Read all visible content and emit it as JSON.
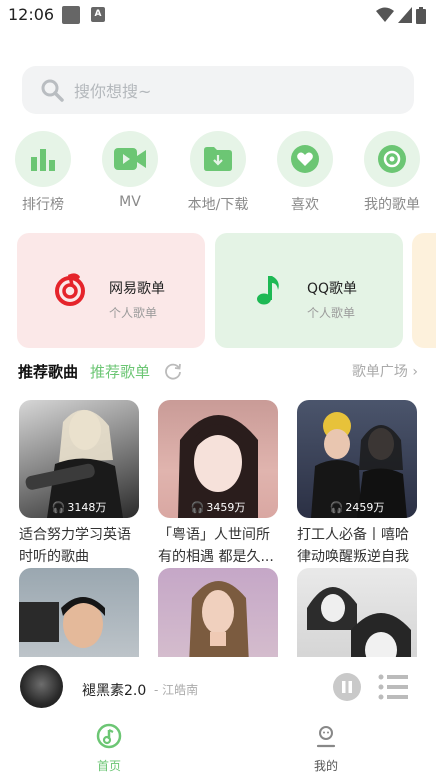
{
  "status": {
    "time": "12:06",
    "notif_letter": "A"
  },
  "search": {
    "placeholder": "搜你想搜~"
  },
  "quick": [
    {
      "label": "排行榜",
      "icon": "bar-chart-icon"
    },
    {
      "label": "MV",
      "icon": "video-camera-icon"
    },
    {
      "label": "本地/下载",
      "icon": "download-folder-icon"
    },
    {
      "label": "喜欢",
      "icon": "heart-icon"
    },
    {
      "label": "我的歌单",
      "icon": "disc-icon"
    }
  ],
  "cards": [
    {
      "title": "网易歌单",
      "subtitle": "个人歌单",
      "icon": "netease-music-icon"
    },
    {
      "title": "QQ歌单",
      "subtitle": "个人歌单",
      "icon": "music-note-icon"
    }
  ],
  "section": {
    "tab_active": "推荐歌曲",
    "tab_other": "推荐歌单",
    "more": "歌单广场 ›"
  },
  "playlists": [
    {
      "plays": "3148万",
      "title": "适合努力学习英语时听的歌曲"
    },
    {
      "plays": "3459万",
      "title": "「粤语」人世间所有的相遇 都是久..."
    },
    {
      "plays": "2459万",
      "title": "打工人必备丨嘻哈律动唤醒叛逆自我"
    },
    {
      "plays": "",
      "title": ""
    },
    {
      "plays": "",
      "title": ""
    },
    {
      "plays": "",
      "title": ""
    }
  ],
  "player": {
    "song": "褪黑素2.0",
    "artist": "- 江皓南"
  },
  "nav": {
    "home": "首页",
    "mine": "我的"
  },
  "colors": {
    "accent": "#6cc674",
    "card_netease": "#fbe8e8",
    "card_qq": "#e4f3e5"
  }
}
